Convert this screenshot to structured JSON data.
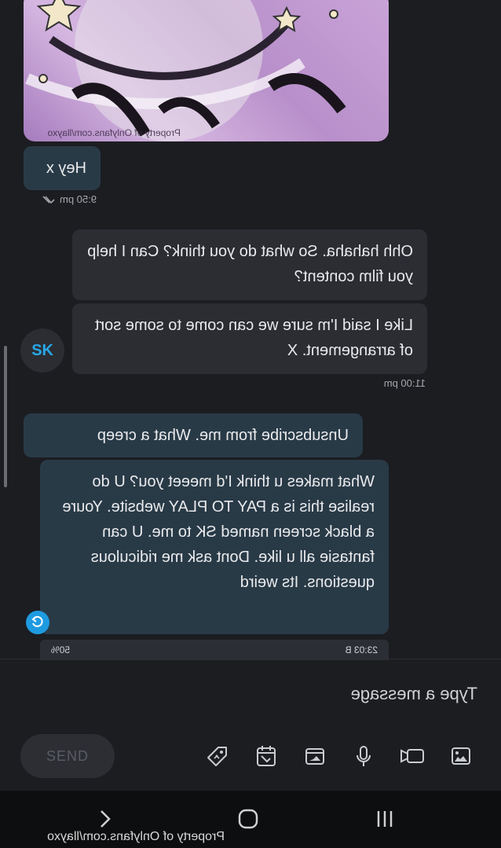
{
  "image_watermark": "Property of Onlyfans.com/llayxo",
  "messages": [
    {
      "id": "hey",
      "text": "Hey x",
      "time": "9:50 pm"
    },
    {
      "id": "hahaha",
      "text": "Ohh hahaha. So what do you think? Can I help you film content?"
    },
    {
      "id": "arrangement",
      "text": "Like I said I'm sure we can come to some sort of arrangement. X",
      "time": "11:00 pm"
    },
    {
      "id": "unsubscribe",
      "text": "Unsubscribe from me. What a creep"
    },
    {
      "id": "rant",
      "text": "What makes u think I'd meeet you? U do realise this is a PAY TO PLAY website. Youre a black screen named SK to me. U can fantasie all u like. Dont ask me ridiculous questions. Its weird"
    }
  ],
  "avatar_initials": "SK",
  "status_strip": {
    "left": "23:03 B",
    "right": "50%"
  },
  "composer": {
    "placeholder": "Type a message",
    "send_label": "SEND"
  },
  "toolbar_icons": [
    "image-icon",
    "video-icon",
    "microphone-icon",
    "media-icon",
    "calendar-icon",
    "price-tag-icon"
  ],
  "bottom_watermark": "Property of Onlyfans.com/llayxo"
}
